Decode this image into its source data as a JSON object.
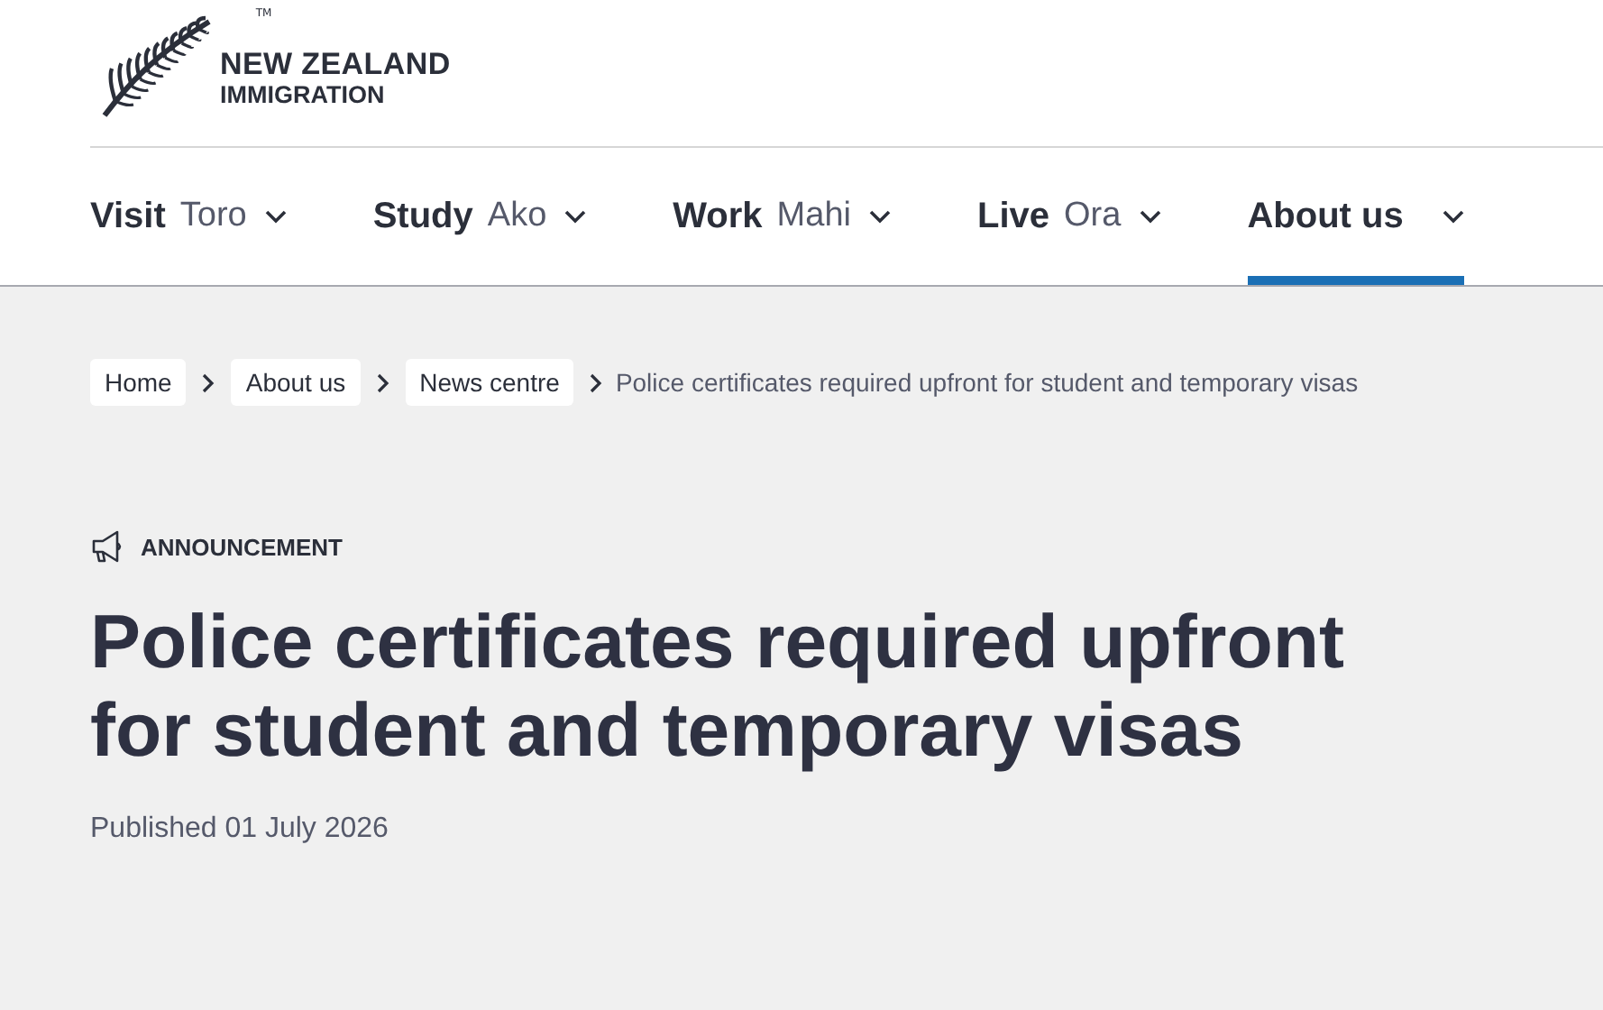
{
  "logo": {
    "name": "NEW ZEALAND",
    "sub": "IMMIGRATION",
    "mark": "TM"
  },
  "nav": [
    {
      "label": "Visit",
      "sub": "Toro",
      "selected": false
    },
    {
      "label": "Study",
      "sub": "Ako",
      "selected": false
    },
    {
      "label": "Work",
      "sub": "Mahi",
      "selected": false
    },
    {
      "label": "Live",
      "sub": "Ora",
      "selected": false
    },
    {
      "label": "About us",
      "selected": true
    }
  ],
  "breadcrumbs": [
    {
      "label": "Home",
      "kind": "link"
    },
    {
      "label": "About us",
      "kind": "link"
    },
    {
      "label": "News centre",
      "kind": "link"
    },
    {
      "label": "Police certificates required upfront for student and temporary visas",
      "kind": "current"
    }
  ],
  "category": "ANNOUNCEMENT",
  "title": "Police certificates required upfront for student and temporary visas",
  "published": "Published 01 July 2026"
}
